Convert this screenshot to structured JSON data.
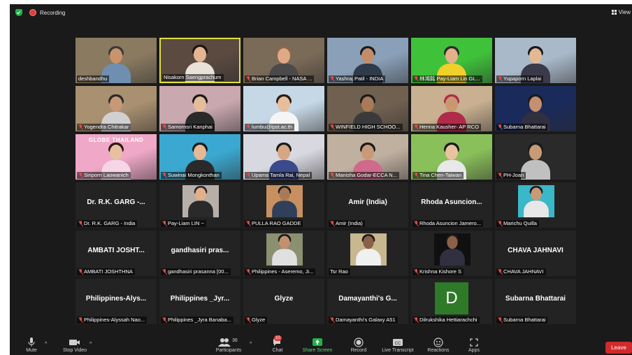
{
  "topbar": {
    "recording_label": "Recording",
    "view_label": "View"
  },
  "tiles": [
    {
      "name": "deshbandhu",
      "muted": false,
      "bg": "#8a7a60",
      "skin": "#c9946a",
      "hair": "#3a3a3a",
      "shirt": "#6f8fb0"
    },
    {
      "name": "Nisakorn Saengprachum",
      "muted": false,
      "active": true,
      "bg": "#5a4a40",
      "skin": "#e3b590",
      "hair": "#1d1410",
      "shirt": "#e8e2d8"
    },
    {
      "name": "Brian Campbell - NASA ...",
      "muted": true,
      "bg": "#7a6a58",
      "skin": "#e0a985",
      "hair": "#8a6a4a",
      "shirt": "#4a4a4a"
    },
    {
      "name": "Yashraj Patil - INDIA",
      "muted": true,
      "bg": "#8aa0b8",
      "skin": "#c28e6a",
      "hair": "#1a1a1a",
      "shirt": "#2f3a4a"
    },
    {
      "name": "林鴻銘 Pay-Liam Lin GL...",
      "muted": true,
      "bg": "#3fc23a",
      "skin": "#e3b08a",
      "hair": "#2a2a2a",
      "shirt": "#f0d02a"
    },
    {
      "name": "Yupaporn Laplai",
      "muted": true,
      "bg": "#a9b9c9",
      "skin": "#e5b894",
      "hair": "#1a1a1a",
      "shirt": "#3a3a4a"
    },
    {
      "name": "Yogendra Chitrakar",
      "muted": true,
      "bg": "#a89070",
      "skin": "#c89878",
      "hair": "#2a2a2a",
      "shirt": "#d0d0d0"
    },
    {
      "name": "Samornsri Kanphai",
      "muted": true,
      "bg": "#c9a8b0",
      "skin": "#e6bc9a",
      "hair": "#1a1a1a",
      "shirt": "#2a2a2a"
    },
    {
      "name": "lumbu@ipst.ac.th",
      "muted": true,
      "bg": "#c6d8e6",
      "skin": "#e7bd9b",
      "hair": "#2a1a14",
      "shirt": "#f5f5f5"
    },
    {
      "name": "WINFIELD HIGH SCHOO...",
      "muted": true,
      "bg": "#706050",
      "skin": "#a97a58",
      "hair": "#1a1a1a",
      "shirt": "#3a3a3a"
    },
    {
      "name": "Henna Kausher- AP RCO",
      "muted": true,
      "bg": "#c8b090",
      "skin": "#c99870",
      "hair": "#b02a4a",
      "shirt": "#b02a4a"
    },
    {
      "name": "Subarna Bhattarai",
      "muted": true,
      "bg": "#1a2a5a",
      "skin": "#c39070",
      "hair": "#1a1a1a",
      "shirt": "#303040"
    },
    {
      "name": "Siriporn Laowanich",
      "muted": true,
      "bg": "#f0a8c8",
      "skin": "#e8c0a0",
      "hair": "#2a1a14",
      "shirt": "#f6d6e6",
      "overlay": "GLOBE THAILAND"
    },
    {
      "name": "Suwinai Mongkonthan",
      "muted": true,
      "bg": "#3aa8d0",
      "skin": "#e6b996",
      "hair": "#1a1a1a",
      "shirt": "#2a2a2a"
    },
    {
      "name": "Upama Tamla Rai, Nepal",
      "muted": true,
      "bg": "#d8d8e0",
      "skin": "#d6a583",
      "hair": "#1a1a1a",
      "shirt": "#3a4a8a"
    },
    {
      "name": "Manisha Godar-ECCA N...",
      "muted": true,
      "bg": "#c0b0a0",
      "skin": "#c99a78",
      "hair": "#1a1a1a",
      "shirt": "#d06a8a"
    },
    {
      "name": "Tina Chen-Taiwan",
      "muted": true,
      "bg": "#8ac05a",
      "skin": "#e9c3a0",
      "hair": "#1a1a1a",
      "shirt": "#e8e8e8"
    },
    {
      "name": "PH-Joan",
      "muted": true,
      "bg": "#2a2a2a",
      "skin": "#c99a78",
      "hair": "#1a1a1a",
      "shirt": "#c0c0c0"
    },
    {
      "name": "Dr. R.K. GARG - India",
      "muted": true,
      "big": "Dr. R.K. GARG -..."
    },
    {
      "name": "Pay-Liam LIN ~",
      "muted": true,
      "photo": true,
      "bg": "#b8b0a8",
      "skin": "#e3b08a",
      "hair": "#2a2a2a",
      "shirt": "#2a2a2a"
    },
    {
      "name": "PULLA RAO GADDE",
      "muted": true,
      "photo": true,
      "bg": "#c89060",
      "skin": "#a87a58",
      "hair": "#1a1a1a",
      "shirt": "#30405a"
    },
    {
      "name": "Amir (India)",
      "muted": true,
      "big": "Amir (India)"
    },
    {
      "name": "Rhoda Asuncion Jamero...",
      "muted": true,
      "big": "Rhoda Asuncion..."
    },
    {
      "name": "Marichu Quilla",
      "muted": true,
      "photo": true,
      "bg": "#3ab8c8",
      "skin": "#c99a78",
      "hair": "#1a1a1a",
      "shirt": "#e8e8e8"
    },
    {
      "name": "AMBATI JOSHTHNA",
      "muted": true,
      "big": "AMBATI JOSHT..."
    },
    {
      "name": "gandhasiri prasanna [00...",
      "muted": true,
      "big": "gandhasiri pras..."
    },
    {
      "name": "Philippines - Aseremo, Ji...",
      "muted": true,
      "photo": true,
      "bg": "#8a9070",
      "skin": "#c39070",
      "hair": "#1a1a1a",
      "shirt": "#e0e0e0"
    },
    {
      "name": "Tsr Rao",
      "muted": false,
      "photo": true,
      "bg": "#c8b890",
      "skin": "#8a6048",
      "hair": "#1a1a1a",
      "shirt": "#f0f0f0"
    },
    {
      "name": "Krishna Kishore S",
      "muted": true,
      "photo": true,
      "bg": "#101010",
      "skin": "#8a6048",
      "hair": "#1a1a1a",
      "shirt": "#303040"
    },
    {
      "name": "CHAVA JAHNAVI",
      "muted": true,
      "big": "CHAVA JAHNAVI"
    },
    {
      "name": "Philippines-Alyssah Nao...",
      "muted": true,
      "big": "Philippines-Alys..."
    },
    {
      "name": "Philippines _Jyra Banaba...",
      "muted": true,
      "big": "Philippines _Jyr..."
    },
    {
      "name": "Glyze",
      "muted": true,
      "big": "Glyze"
    },
    {
      "name": "Damayanthi's Galaxy A51",
      "muted": true,
      "big": "Damayanthi's G..."
    },
    {
      "name": "Dilrukshika Hettiarachchi",
      "muted": true,
      "letter": "D"
    },
    {
      "name": "Subarna Bhattarai",
      "muted": true,
      "big": "Subarna Bhattarai"
    }
  ],
  "toolbar": {
    "mute": "Mute",
    "stop_video": "Stop Video",
    "participants": "Participants",
    "participants_count": "36",
    "chat": "Chat",
    "chat_badge": "10",
    "share_screen": "Share Screen",
    "record": "Record",
    "live_transcript": "Live Transcript",
    "reactions": "Reactions",
    "apps": "Apps",
    "leave": "Leave"
  },
  "colors": {
    "share_green": "#23b04a",
    "leave_red": "#d12a2a",
    "active_border": "#dfe040"
  }
}
